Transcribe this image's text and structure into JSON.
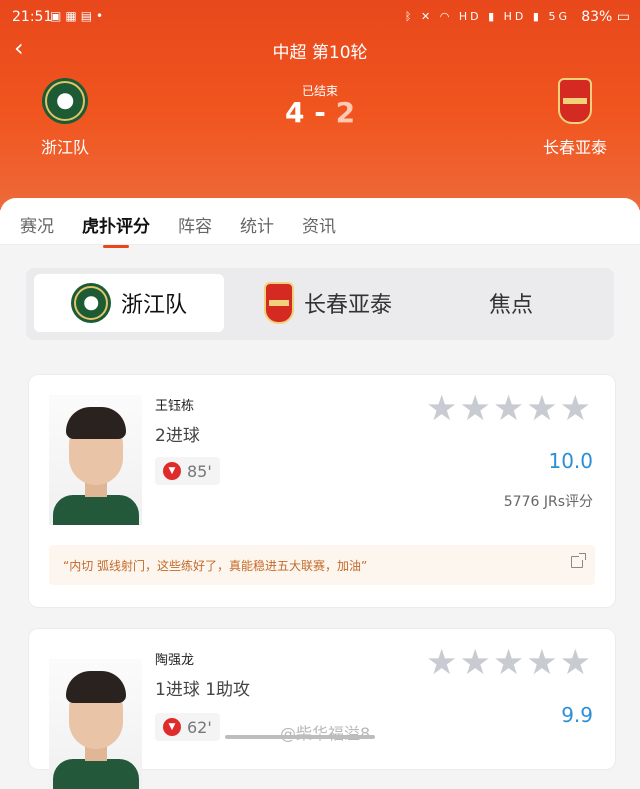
{
  "status_bar": {
    "time": "21:51",
    "notification_icons": [
      "image-icon",
      "app-icon",
      "doc-icon",
      "dot-icon"
    ],
    "indicator_icons": [
      "bluetooth-icon",
      "mute-icon",
      "wifi-icon",
      "signal-icon",
      "signal-icon"
    ],
    "hd_labels": [
      "HD",
      "HD",
      "5G"
    ],
    "battery": "83%"
  },
  "header": {
    "title": "中超 第10轮",
    "status": "已结束",
    "home_score": "4",
    "separator": "-",
    "away_score": "2",
    "home_team": "浙江队",
    "away_team": "长春亚泰"
  },
  "tabs": [
    {
      "label": "赛况",
      "active": false
    },
    {
      "label": "虎扑评分",
      "active": true
    },
    {
      "label": "阵容",
      "active": false
    },
    {
      "label": "统计",
      "active": false
    },
    {
      "label": "资讯",
      "active": false
    }
  ],
  "subtabs": [
    {
      "label": "浙江队",
      "active": true
    },
    {
      "label": "长春亚泰",
      "active": false
    },
    {
      "label": "焦点",
      "active": false
    }
  ],
  "players": [
    {
      "name": "王钰栋",
      "stat": "2进球",
      "sub_minute": "85'",
      "rating": "10.0",
      "votes": "5776 JRs评分",
      "stars_filled": 0,
      "comment": "“内切 弧线射门，这些练好了，真能稳进五大联赛，加油”"
    },
    {
      "name": "陶强龙",
      "stat": "1进球 1助攻",
      "sub_minute": "62'",
      "rating": "9.9",
      "stars_filled": 0
    }
  ],
  "watermark": "@柴华福溢8",
  "colors": {
    "header_orange": "#e8481b",
    "rating_blue": "#2b8fd6",
    "comment_text": "#c46a2a",
    "star_gray": "#c9cbd2"
  }
}
